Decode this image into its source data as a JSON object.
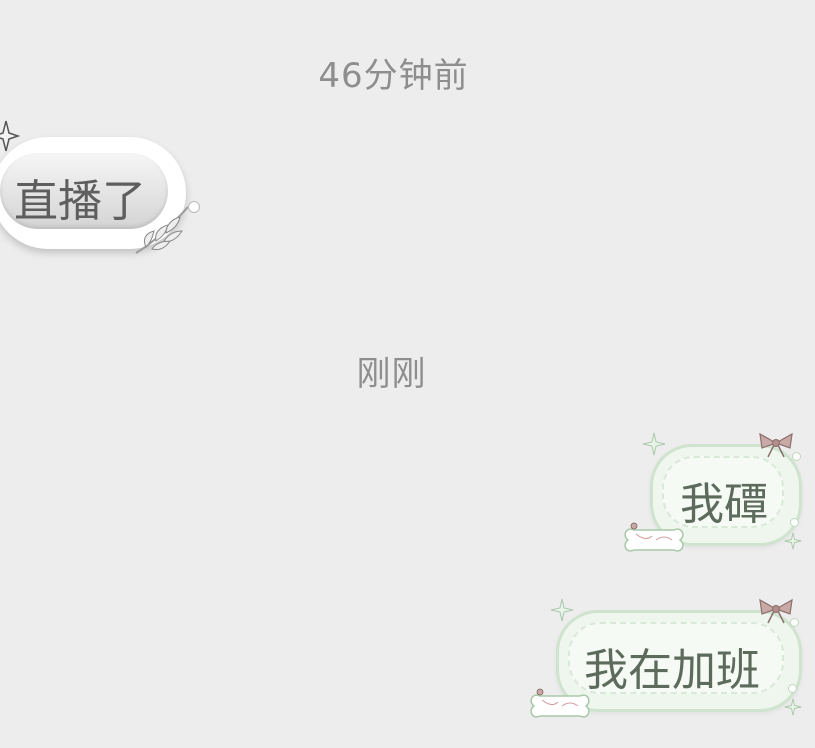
{
  "timestamps": [
    "46分钟前",
    "刚刚"
  ],
  "messages": [
    {
      "direction": "incoming",
      "text": "直播了",
      "bubble_theme": "silver"
    },
    {
      "direction": "outgoing",
      "text": "我磹",
      "bubble_theme": "mint"
    },
    {
      "direction": "outgoing",
      "text": "我在加班",
      "bubble_theme": "mint"
    }
  ],
  "colors": {
    "background": "#ededed",
    "timestamp_text": "#8e8e8e",
    "incoming_text": "#5e5e5e",
    "outgoing_text": "#5d6b5c",
    "outgoing_bubble": "#eef6ee",
    "outgoing_border": "#cfe3cf"
  },
  "icons": [
    "sparkle-icon",
    "leaf-icon",
    "bow-icon",
    "star-icon",
    "bone-sticker-icon"
  ]
}
